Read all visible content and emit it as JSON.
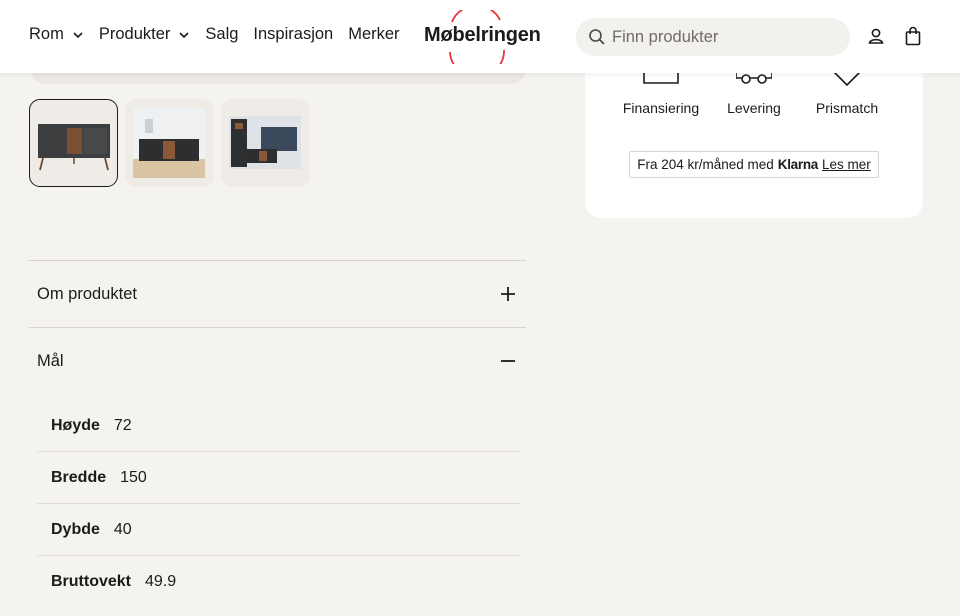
{
  "header": {
    "nav": [
      {
        "label": "Rom",
        "dropdown": true
      },
      {
        "label": "Produkter",
        "dropdown": true
      },
      {
        "label": "Salg",
        "dropdown": false
      },
      {
        "label": "Inspirasjon",
        "dropdown": false
      },
      {
        "label": "Merker",
        "dropdown": false
      }
    ],
    "logo_text": "Møbelringen",
    "search_placeholder": "Finn produkter",
    "icons": [
      "account-icon",
      "cart-icon"
    ],
    "logo_color": "#e4363b"
  },
  "gallery": {
    "thumbnails": [
      "sideboard-front",
      "sideboard-room",
      "sideboard-livingroom"
    ],
    "active_index": 0
  },
  "card": {
    "usps": [
      {
        "label": "Finansiering",
        "icon": "finance-icon"
      },
      {
        "label": "Levering",
        "icon": "delivery-icon"
      },
      {
        "label": "Prismatch",
        "icon": "pricematch-icon"
      }
    ],
    "klarna": {
      "prefix": "Fra 204 kr/måned med",
      "brand": "Klarna",
      "link": "Les mer"
    }
  },
  "accordion": {
    "about_title": "Om produktet",
    "dims_title": "Mål",
    "dims": [
      {
        "label": "Høyde",
        "value": "72"
      },
      {
        "label": "Bredde",
        "value": "150"
      },
      {
        "label": "Dybde",
        "value": "40"
      },
      {
        "label": "Bruttovekt",
        "value": "49.9"
      }
    ]
  }
}
